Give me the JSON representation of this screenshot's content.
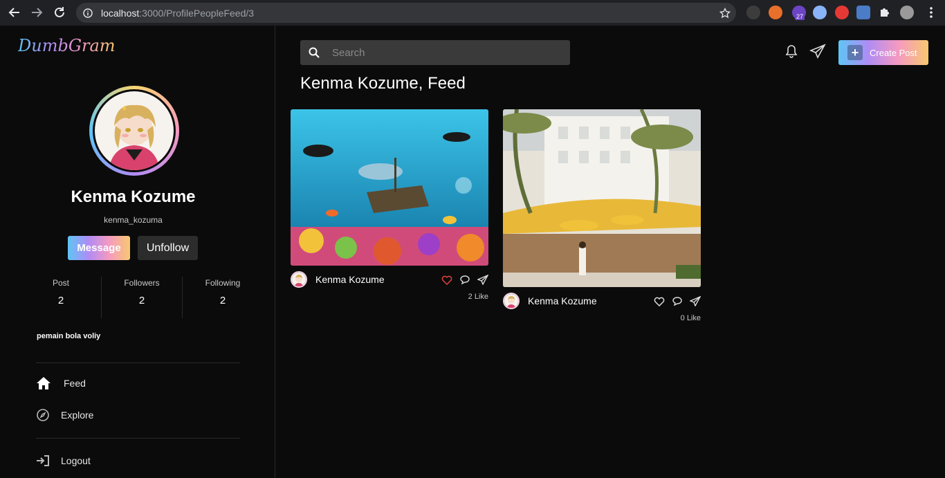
{
  "browser": {
    "url_host": "localhost",
    "url_path": ":3000/ProfilePeopleFeed/3",
    "extension_badge": "27"
  },
  "brand": {
    "logo": "DumbGram"
  },
  "profile": {
    "name": "Kenma Kozume",
    "username": "kenma_kozuma",
    "message_label": "Message",
    "unfollow_label": "Unfollow",
    "stats": [
      {
        "label": "Post",
        "value": "2"
      },
      {
        "label": "Followers",
        "value": "2"
      },
      {
        "label": "Following",
        "value": "2"
      }
    ],
    "bio": "pemain bola voliy"
  },
  "menu": {
    "feed": "Feed",
    "explore": "Explore",
    "logout": "Logout"
  },
  "header": {
    "search_placeholder": "Search",
    "create_post_label": "Create Post"
  },
  "feed": {
    "title": "Kenma Kozume, Feed",
    "posts": [
      {
        "user": "Kenma Kozume",
        "likes": "2 Like",
        "liked": true,
        "image": "underwater-reef-scene"
      },
      {
        "user": "Kenma Kozume",
        "likes": "0 Like",
        "liked": false,
        "image": "beach-hotel-cafe"
      }
    ]
  },
  "colors": {
    "accent_gradient": [
      "#5ec5f5",
      "#b08cf5",
      "#f59ac0",
      "#f8c870"
    ],
    "liked_heart": "#e0413f",
    "background": "#0b0b0b"
  }
}
